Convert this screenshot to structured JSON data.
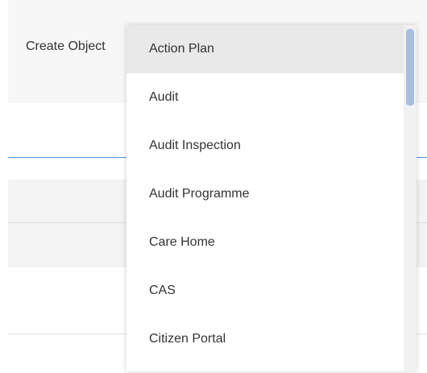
{
  "form": {
    "create_object_label": "Create Object"
  },
  "dropdown": {
    "items": [
      {
        "label": "Action Plan",
        "highlighted": true
      },
      {
        "label": "Audit",
        "highlighted": false
      },
      {
        "label": "Audit Inspection",
        "highlighted": false
      },
      {
        "label": "Audit Programme",
        "highlighted": false
      },
      {
        "label": "Care Home",
        "highlighted": false
      },
      {
        "label": "CAS",
        "highlighted": false
      },
      {
        "label": "Citizen Portal",
        "highlighted": false
      }
    ]
  },
  "colors": {
    "accent_line": "#4a8fd6",
    "highlight": "#e9e9e9",
    "scroll_thumb": "#a9bedf"
  }
}
